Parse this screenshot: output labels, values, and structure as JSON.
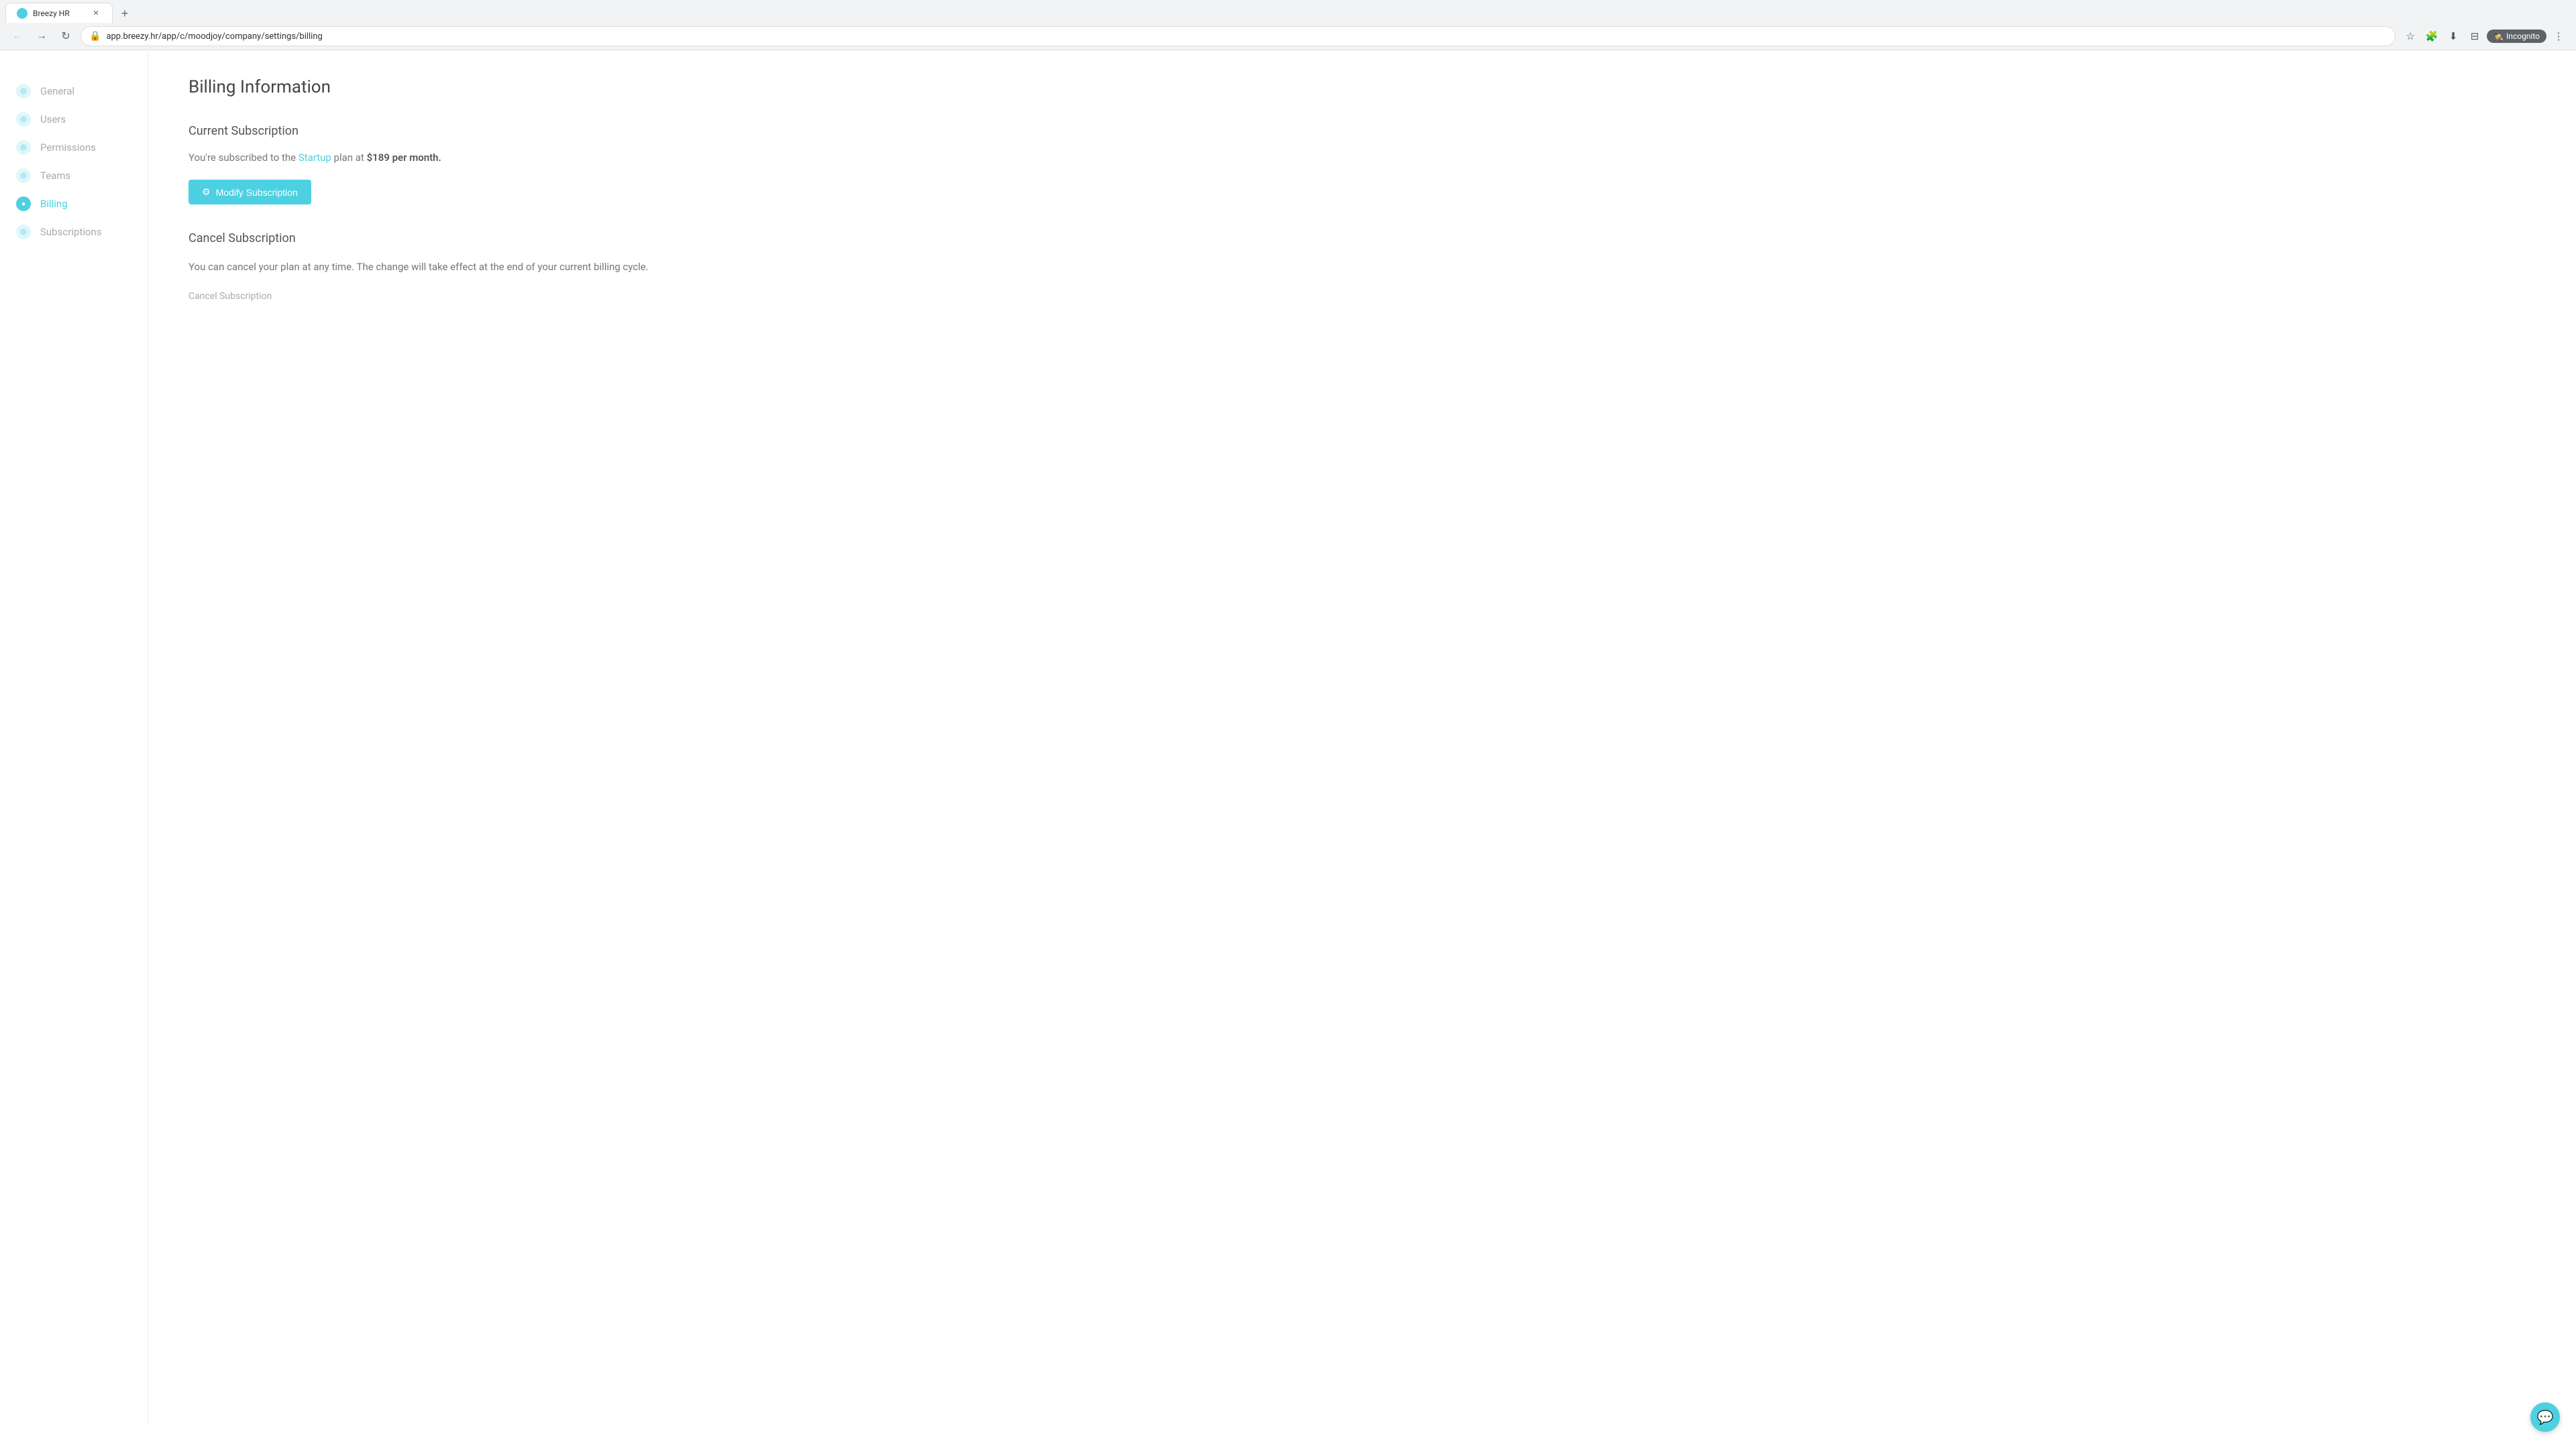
{
  "browser": {
    "tab_label": "Breezy HR",
    "address": "app.breezy.hr/app/c/moodjoy/company/settings/billing",
    "incognito_label": "Incognito"
  },
  "sidebar": {
    "items": [
      {
        "id": "general",
        "label": "General",
        "active": false
      },
      {
        "id": "users",
        "label": "Users",
        "active": false
      },
      {
        "id": "permissions",
        "label": "Permissions",
        "active": false
      },
      {
        "id": "teams",
        "label": "Teams",
        "active": false
      },
      {
        "id": "billing",
        "label": "Billing",
        "active": true
      },
      {
        "id": "subscriptions",
        "label": "Subscriptions",
        "active": false
      }
    ]
  },
  "main": {
    "page_title": "Billing Information",
    "current_subscription": {
      "section_title": "Current Subscription",
      "description_prefix": "You're subscribed to the ",
      "plan_name": "Startup",
      "description_suffix": " plan at ",
      "price": "$189 per month.",
      "modify_btn_label": "Modify Subscription"
    },
    "cancel_subscription": {
      "section_title": "Cancel Subscription",
      "description": "You can cancel your plan at any time. The change will take effect at the end of your current billing cycle.",
      "cancel_link_label": "Cancel Subscription"
    }
  },
  "chat_widget": {
    "icon": "💬"
  }
}
